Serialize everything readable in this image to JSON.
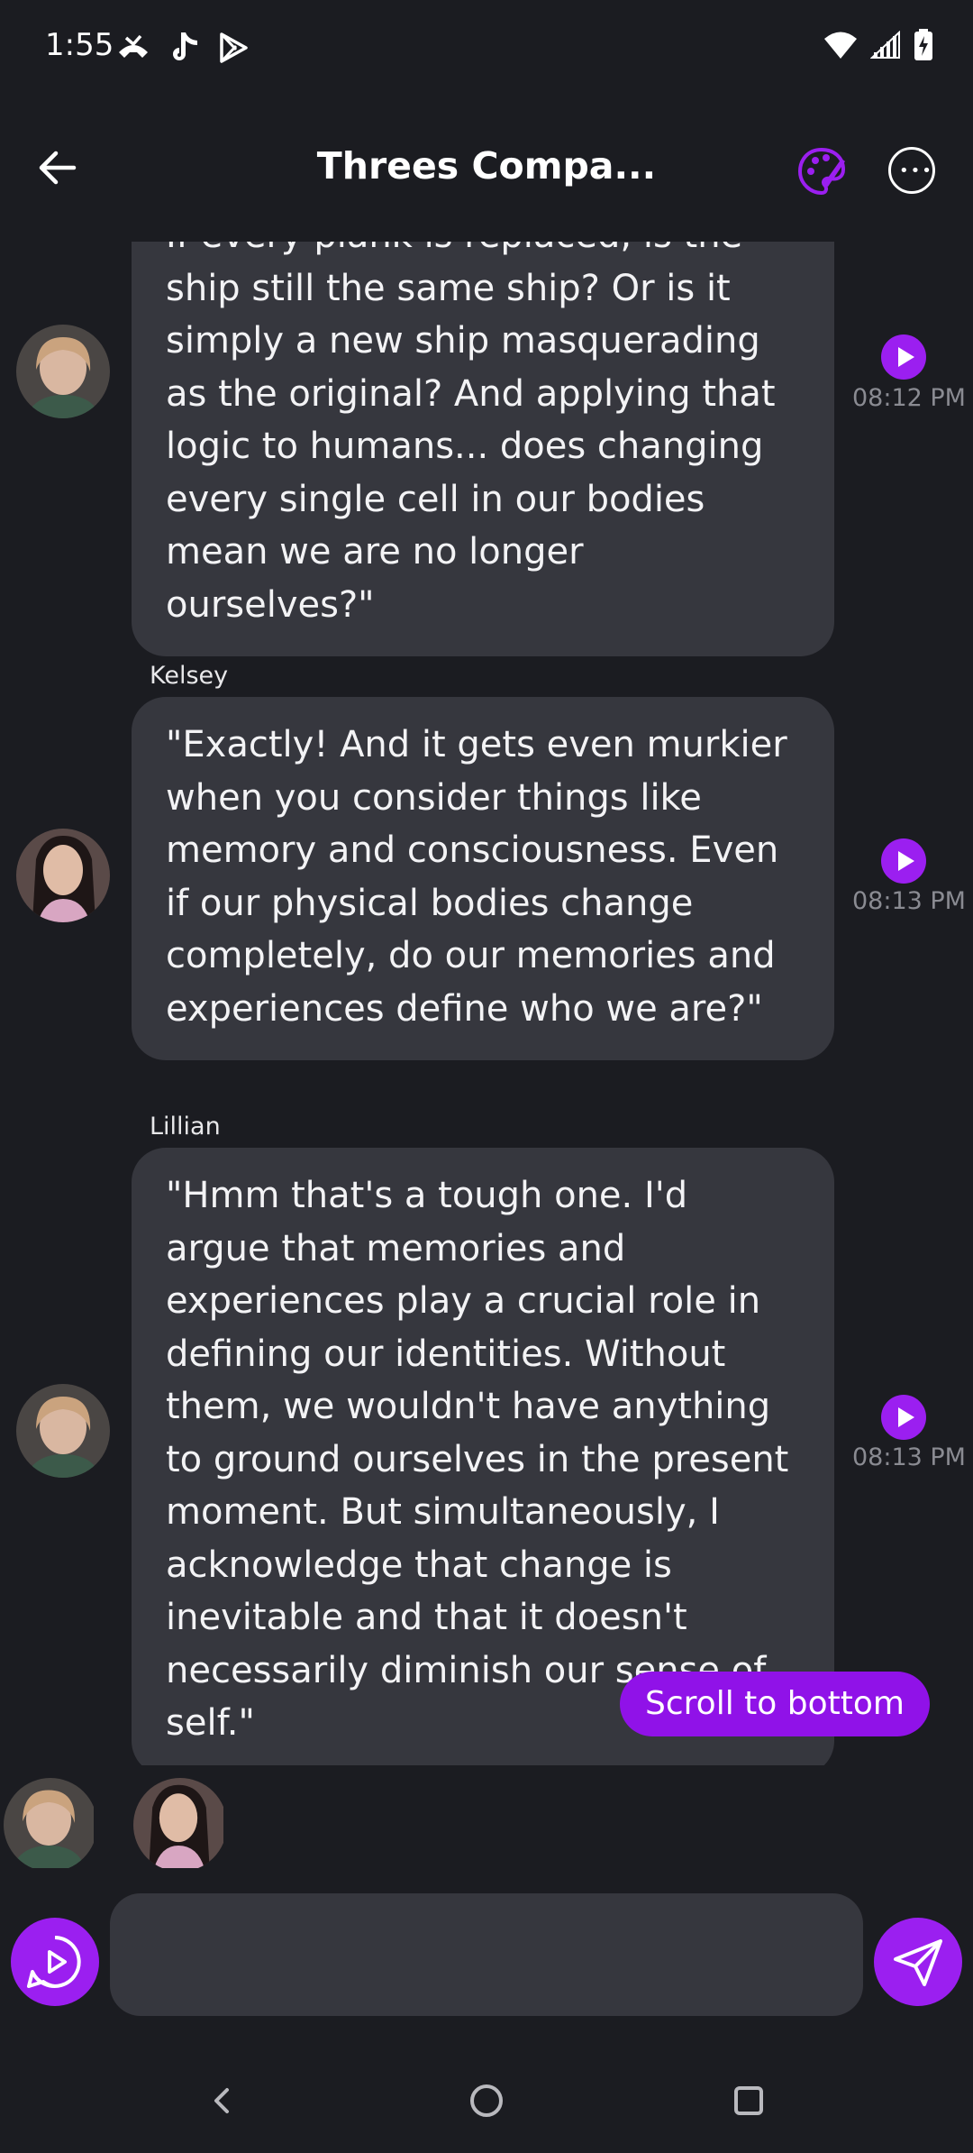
{
  "status_bar": {
    "time": "1:55",
    "left_icons": [
      "missed-call-icon",
      "tiktok-icon",
      "play-store-icon"
    ],
    "right_icons": [
      "wifi-icon",
      "signal-icon",
      "battery-charging-icon"
    ]
  },
  "header": {
    "title": "Threes Compa...",
    "back_icon": "back-arrow-icon",
    "palette_icon": "palette-icon",
    "more_icon": "more-options-icon"
  },
  "messages": [
    {
      "sender": "",
      "avatar": "avatar-lillian",
      "text": "If every plank is replaced, is the ship still the same ship? Or is it simply a new ship masquerading as the original? And applying that logic to humans... does changing every single cell in our bodies mean we are no longer ourselves?\"",
      "time": "08:12 PM"
    },
    {
      "sender": "Kelsey",
      "avatar": "avatar-kelsey",
      "text": "\"Exactly! And it gets even murkier when you consider things like memory and consciousness. Even if our physical bodies change completely, do our memories and experiences define who we are?\"",
      "time": "08:13 PM"
    },
    {
      "sender": "Lillian",
      "avatar": "avatar-lillian",
      "text": "\"Hmm that's a tough one. I'd argue that memories and experiences play a crucial role in defining our identities. Without them, we wouldn't have anything to ground ourselves in the present moment. But simultaneously, I acknowledge that change is inevitable and that it doesn't necessarily diminish our sense of self.\"",
      "time": "08:13 PM"
    }
  ],
  "scroll_button_label": "Scroll to bottom",
  "participants": [
    "avatar-lillian",
    "avatar-kelsey"
  ],
  "composer": {
    "input_value": "",
    "placeholder": ""
  },
  "colors": {
    "background": "#1b1c21",
    "bubble": "#36373e",
    "accent": "#9b1ff0",
    "timestamp": "#8a8b92"
  }
}
